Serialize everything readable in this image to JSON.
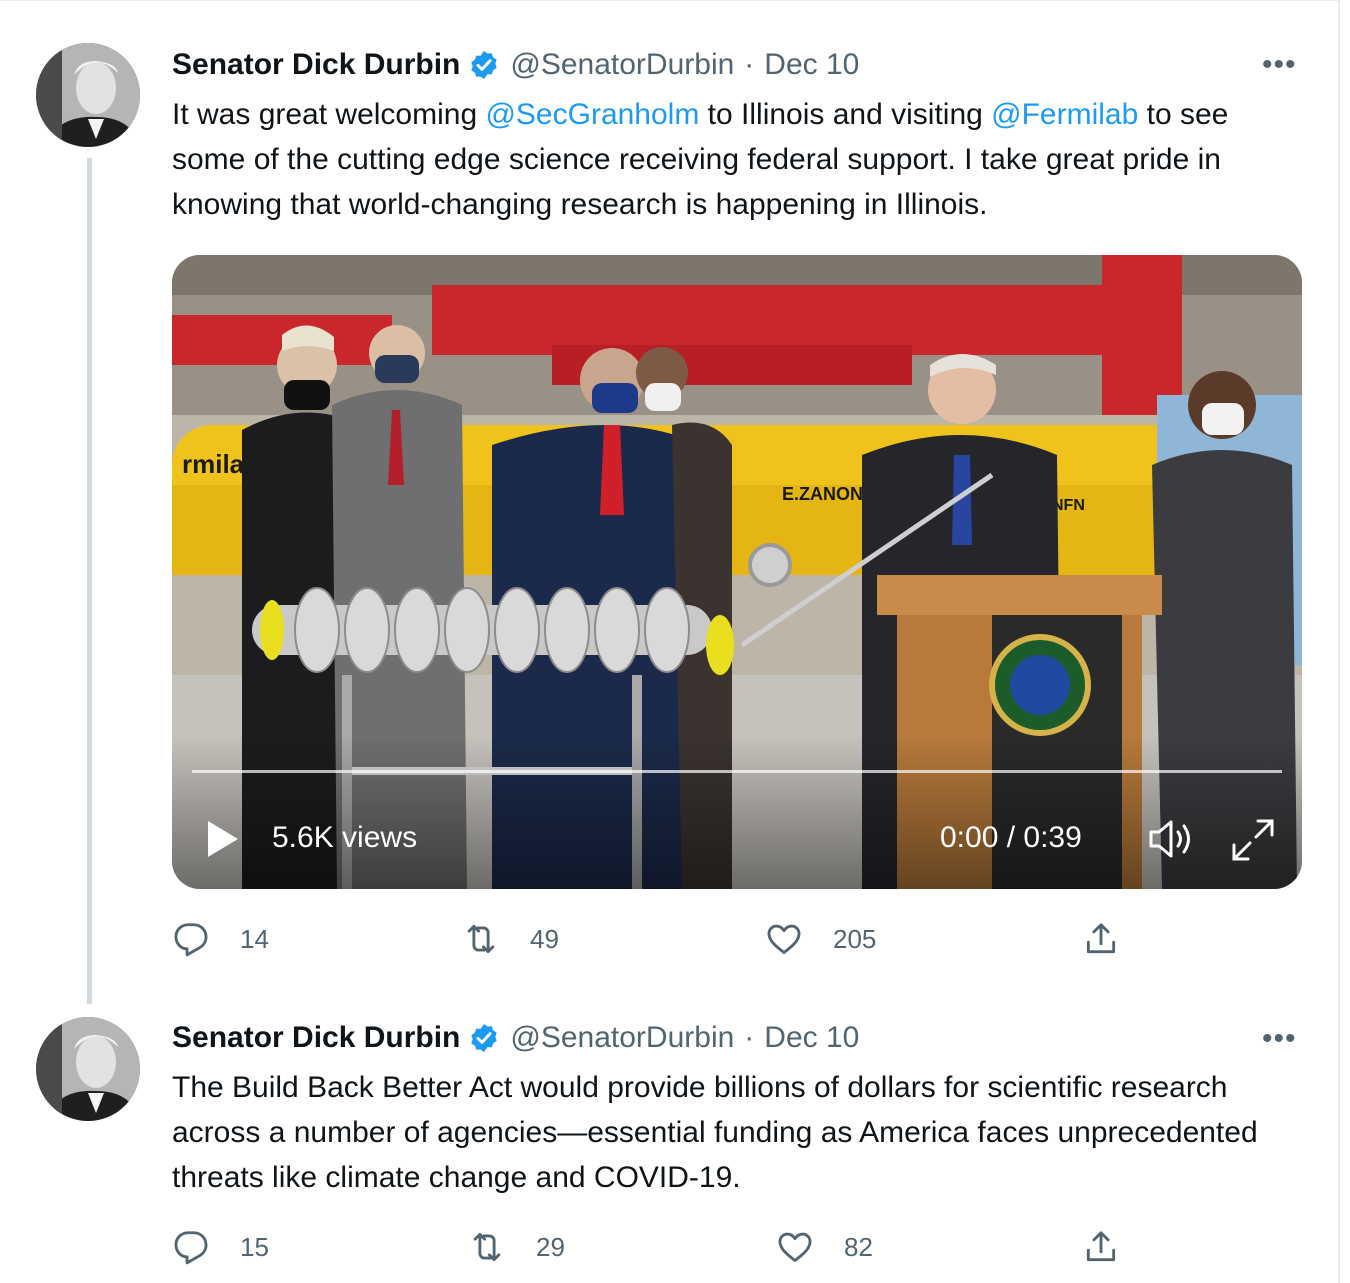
{
  "colors": {
    "accent": "#1d9bf0",
    "text": "#0f1419",
    "muted": "#536471",
    "thread_line": "#cfd9de"
  },
  "tweets": [
    {
      "author_name": "Senator Dick Durbin",
      "handle": "@SenatorDurbin",
      "separator": "·",
      "date": "Dec 10",
      "more_label": "•••",
      "text_parts": [
        "It was great welcoming ",
        "@SecGranholm",
        " to Illinois and visiting ",
        "@Fermilab",
        " to see some of the cutting edge science receiving federal support. I take great pride in knowing that world-changing research is happening in Illinois."
      ],
      "video": {
        "views": "5.6K views",
        "time": "0:00 / 0:39",
        "signage": [
          "rmila",
          "E.ZANON",
          "NFN"
        ],
        "progress_fraction": 0
      },
      "replies": "14",
      "retweets": "49",
      "likes": "205"
    },
    {
      "author_name": "Senator Dick Durbin",
      "handle": "@SenatorDurbin",
      "separator": "·",
      "date": "Dec 10",
      "more_label": "•••",
      "text": "The Build Back Better Act would provide billions of dollars for scientific research across a number of agencies—essential funding as America faces unprecedented threats like climate change and COVID-19.",
      "replies": "15",
      "retweets": "29",
      "likes": "82"
    }
  ],
  "icons": {
    "reply": "reply-icon",
    "retweet": "retweet-icon",
    "like": "like-icon",
    "share": "share-icon",
    "verified": "verified-badge-icon",
    "play": "play-icon",
    "volume": "volume-icon",
    "fullscreen": "fullscreen-icon"
  }
}
